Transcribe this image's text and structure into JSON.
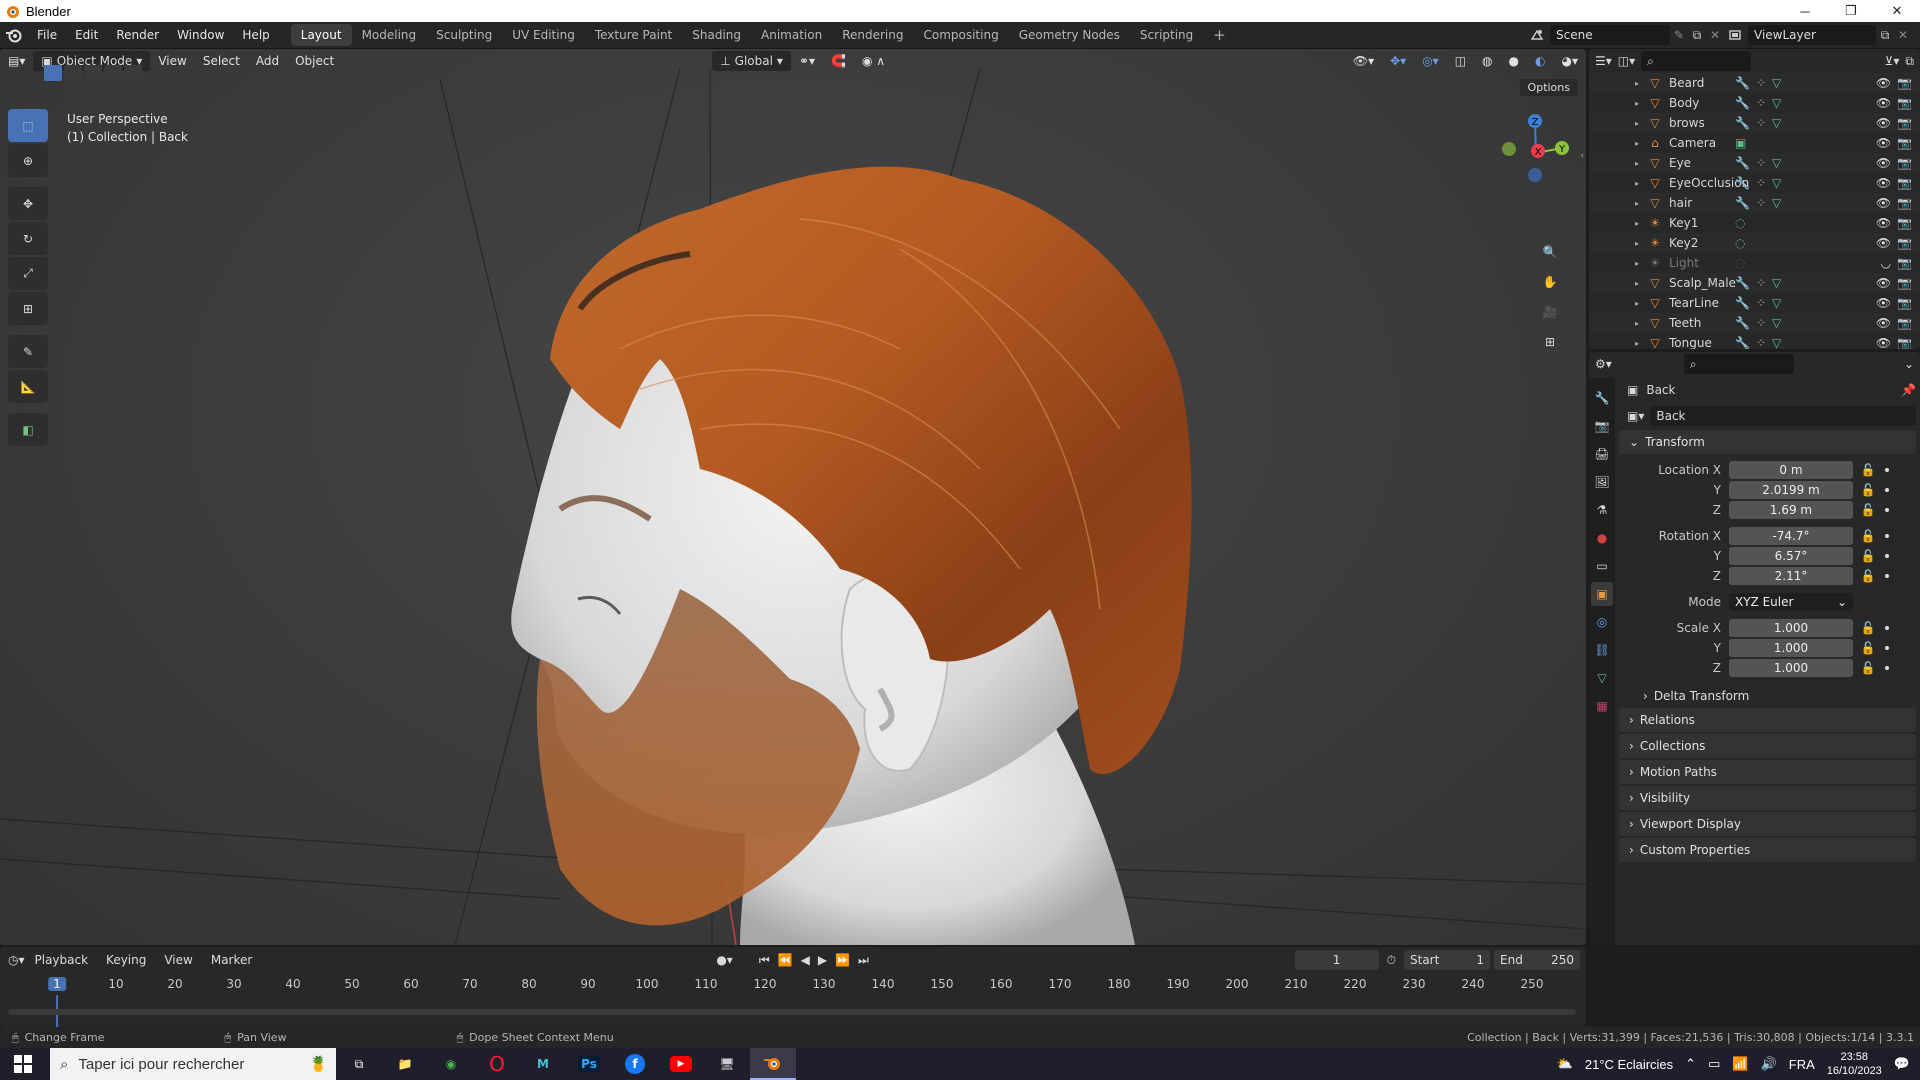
{
  "window": {
    "title": "Blender",
    "minimize": "─",
    "maximize": "❐",
    "close": "✕"
  },
  "menubar": {
    "items": [
      "File",
      "Edit",
      "Render",
      "Window",
      "Help"
    ]
  },
  "workspaces": {
    "tabs": [
      "Layout",
      "Modeling",
      "Sculpting",
      "UV Editing",
      "Texture Paint",
      "Shading",
      "Animation",
      "Rendering",
      "Compositing",
      "Geometry Nodes",
      "Scripting"
    ],
    "active": "Layout",
    "add": "+"
  },
  "scene": {
    "name": "Scene",
    "view_layer": "ViewLayer"
  },
  "viewport": {
    "mode": "Object Mode",
    "menus": [
      "View",
      "Select",
      "Add",
      "Object"
    ],
    "orientation": "Global",
    "options": "Options",
    "info_line1": "User Perspective",
    "info_line2": "(1) Collection | Back",
    "gizmo_axes": {
      "z": "Z",
      "y": "Y",
      "x": "X"
    },
    "axis_colors": {
      "x": "#ee3b4f",
      "y": "#8bc43b",
      "z": "#3c82d8"
    }
  },
  "outliner": {
    "objects": [
      {
        "name": "Beard",
        "icon": "mesh-triangle-icon",
        "dim": false
      },
      {
        "name": "Body",
        "icon": "mesh-triangle-icon",
        "dim": false
      },
      {
        "name": "brows",
        "icon": "mesh-triangle-icon",
        "dim": false
      },
      {
        "name": "Camera",
        "icon": "camera-icon",
        "dim": false
      },
      {
        "name": "Eye",
        "icon": "mesh-triangle-icon",
        "dim": false
      },
      {
        "name": "EyeOcclusion",
        "icon": "mesh-triangle-icon",
        "dim": false
      },
      {
        "name": "hair",
        "icon": "mesh-triangle-icon",
        "dim": false
      },
      {
        "name": "Key1",
        "icon": "light-icon",
        "dim": false
      },
      {
        "name": "Key2",
        "icon": "light-icon",
        "dim": false
      },
      {
        "name": "Light",
        "icon": "light-icon",
        "dim": true
      },
      {
        "name": "Scalp_Male",
        "icon": "mesh-triangle-icon",
        "dim": false
      },
      {
        "name": "TearLine",
        "icon": "mesh-triangle-icon",
        "dim": false
      },
      {
        "name": "Teeth",
        "icon": "mesh-triangle-icon",
        "dim": false
      },
      {
        "name": "Tongue",
        "icon": "mesh-triangle-icon",
        "dim": false
      }
    ]
  },
  "properties": {
    "object_name": "Back",
    "data_name": "Back",
    "transform_label": "Transform",
    "location": {
      "label_x": "Location X",
      "x": "0 m",
      "y": "2.0199 m",
      "z": "1.69 m"
    },
    "rotation": {
      "label_x": "Rotation X",
      "x": "-74.7°",
      "y": "6.57°",
      "z": "2.11°"
    },
    "mode_label": "Mode",
    "mode_value": "XYZ Euler",
    "scale": {
      "label_x": "Scale X",
      "x": "1.000",
      "y": "1.000",
      "z": "1.000"
    },
    "y_label": "Y",
    "z_label": "Z",
    "sections": [
      "Delta Transform",
      "Relations",
      "Collections",
      "Motion Paths",
      "Visibility",
      "Viewport Display",
      "Custom Properties"
    ]
  },
  "timeline": {
    "menus": [
      "Playback",
      "Keying",
      "View",
      "Marker"
    ],
    "current_frame": "1",
    "start_label": "Start",
    "start": "1",
    "end_label": "End",
    "end": "250",
    "ruler": [
      "1",
      "10",
      "20",
      "30",
      "40",
      "50",
      "60",
      "70",
      "80",
      "90",
      "100",
      "110",
      "120",
      "130",
      "140",
      "150",
      "160",
      "170",
      "180",
      "190",
      "200",
      "210",
      "220",
      "230",
      "240",
      "250"
    ]
  },
  "statusbar": {
    "left1": "Change Frame",
    "left2": "Pan View",
    "left3": "Dope Sheet Context Menu",
    "right": "Collection | Back | Verts:31,399 | Faces:21,536 | Tris:30,808 | Objects:1/14 | 3.3.1"
  },
  "taskbar": {
    "search_placeholder": "Taper ici pour rechercher",
    "weather": "21°C Eclaircies",
    "lang": "FRA",
    "time": "23:58",
    "date": "16/10/2023"
  }
}
